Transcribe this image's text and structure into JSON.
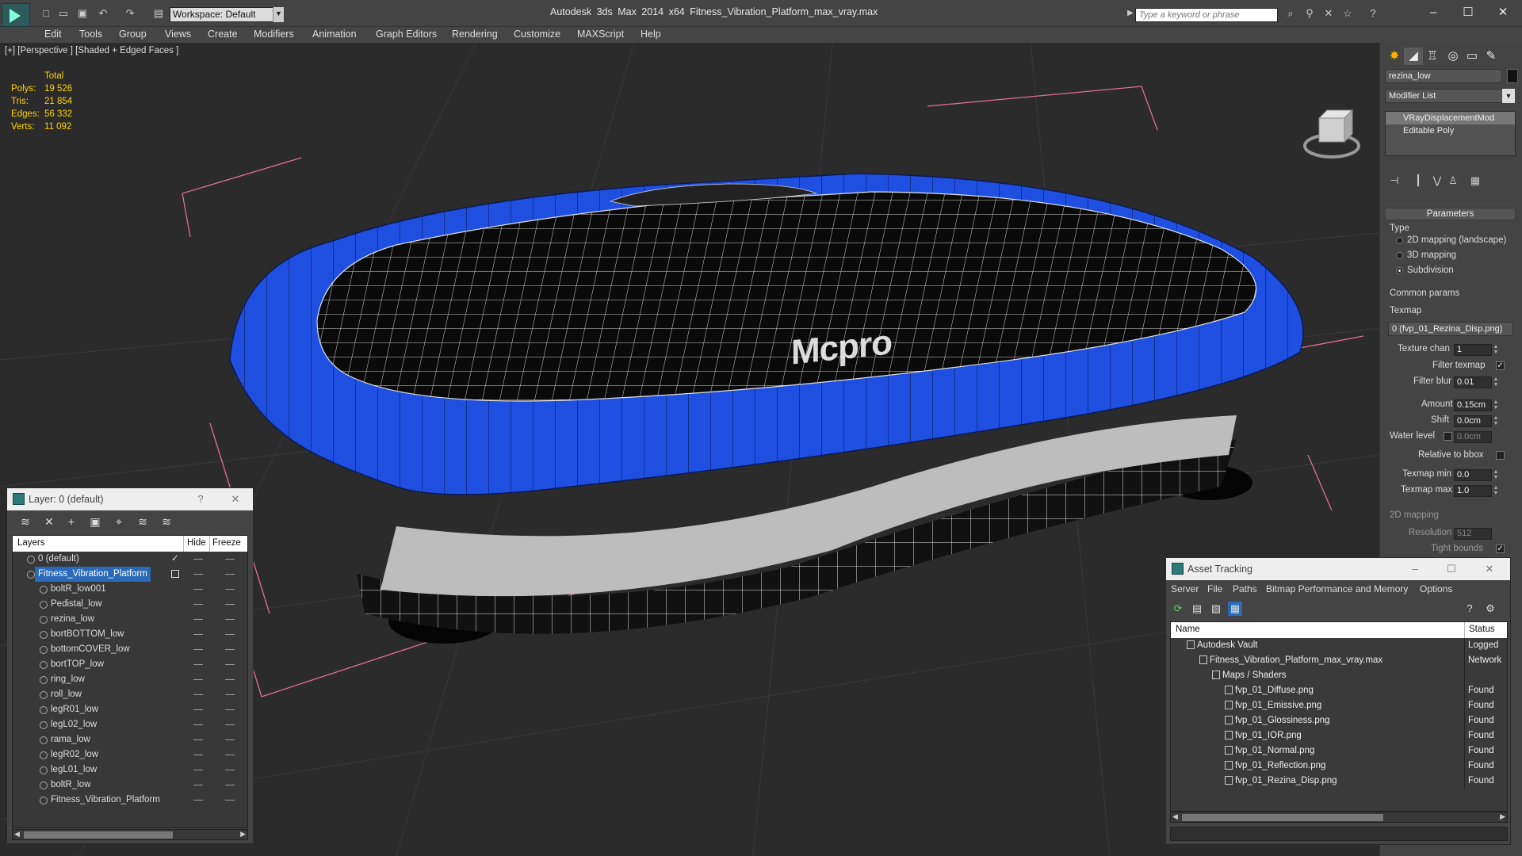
{
  "app": {
    "title": "Autodesk 3ds Max  2014 x64      Fitness_Vibration_Platform_max_vray.max",
    "workspace": "Workspace: Default",
    "search_placeholder": "Type a keyword or phrase"
  },
  "menu": [
    "Edit",
    "Tools",
    "Group",
    "Views",
    "Create",
    "Modifiers",
    "Animation",
    "Graph Editors",
    "Rendering",
    "Customize",
    "MAXScript",
    "Help"
  ],
  "viewport": {
    "label": "[+] [Perspective ] [Shaded + Edged Faces ]",
    "logo_text": "Mcpro",
    "stats": {
      "header": "Total",
      "rows": [
        {
          "k": "Polys:",
          "v": "19 526"
        },
        {
          "k": "Tris:",
          "v": "21 854"
        },
        {
          "k": "Edges:",
          "v": "56 332"
        },
        {
          "k": "Verts:",
          "v": "11 092"
        }
      ]
    }
  },
  "command_panel": {
    "object_name": "rezina_low",
    "modifier_list": "Modifier List",
    "stack": [
      "VRayDisplacementMod",
      "Editable Poly"
    ],
    "rollout_parameters": "Parameters",
    "type_label": "Type",
    "types": [
      "2D mapping (landscape)",
      "3D mapping",
      "Subdivision"
    ],
    "common_params": "Common params",
    "texmap_label": "Texmap",
    "texmap_value": "0 (fvp_01_Rezina_Disp.png)",
    "texture_chan_label": "Texture chan",
    "texture_chan": "1",
    "filter_texmap": "Filter texmap",
    "filter_blur_label": "Filter blur",
    "filter_blur": "0.01",
    "amount_label": "Amount",
    "amount": "0.15cm",
    "shift_label": "Shift",
    "shift": "0.0cm",
    "water_level_label": "Water level",
    "water_level": "0.0cm",
    "relative_bbox": "Relative to bbox",
    "texmap_min_label": "Texmap min",
    "texmap_min": "0.0",
    "texmap_max_label": "Texmap max",
    "texmap_max": "1.0",
    "mapping2d": "2D mapping",
    "resolution_label": "Resolution",
    "resolution": "512",
    "tight_bounds": "Tight bounds"
  },
  "layers": {
    "title": "Layer: 0 (default)",
    "help": "?",
    "col_layers": "Layers",
    "col_hide": "Hide",
    "col_freeze": "Freeze",
    "rows": [
      {
        "name": "0 (default)",
        "level": 0
      },
      {
        "name": "Fitness_Vibration_Platform",
        "level": 0,
        "selected": true
      },
      {
        "name": "boltR_low001",
        "level": 1
      },
      {
        "name": "Pedistal_low",
        "level": 1
      },
      {
        "name": "rezina_low",
        "level": 1
      },
      {
        "name": "bortBOTTOM_low",
        "level": 1
      },
      {
        "name": "bottomCOVER_low",
        "level": 1
      },
      {
        "name": "bortTOP_low",
        "level": 1
      },
      {
        "name": "ring_low",
        "level": 1
      },
      {
        "name": "roll_low",
        "level": 1
      },
      {
        "name": "legR01_low",
        "level": 1
      },
      {
        "name": "legL02_low",
        "level": 1
      },
      {
        "name": "rama_low",
        "level": 1
      },
      {
        "name": "legR02_low",
        "level": 1
      },
      {
        "name": "legL01_low",
        "level": 1
      },
      {
        "name": "boltR_low",
        "level": 1
      },
      {
        "name": "Fitness_Vibration_Platform",
        "level": 1
      }
    ]
  },
  "asset": {
    "title": "Asset Tracking",
    "menu": [
      "Server",
      "File",
      "Paths",
      "Bitmap Performance and Memory",
      "Options"
    ],
    "col_name": "Name",
    "col_status": "Status",
    "rows": [
      {
        "name": "Autodesk Vault",
        "status": "Logged",
        "indent": 0
      },
      {
        "name": "Fitness_Vibration_Platform_max_vray.max",
        "status": "Network",
        "indent": 1
      },
      {
        "name": "Maps / Shaders",
        "status": "",
        "indent": 2
      },
      {
        "name": "fvp_01_Diffuse.png",
        "status": "Found",
        "indent": 3
      },
      {
        "name": "fvp_01_Emissive.png",
        "status": "Found",
        "indent": 3
      },
      {
        "name": "fvp_01_Glossiness.png",
        "status": "Found",
        "indent": 3
      },
      {
        "name": "fvp_01_IOR.png",
        "status": "Found",
        "indent": 3
      },
      {
        "name": "fvp_01_Normal.png",
        "status": "Found",
        "indent": 3
      },
      {
        "name": "fvp_01_Reflection.png",
        "status": "Found",
        "indent": 3
      },
      {
        "name": "fvp_01_Rezina_Disp.png",
        "status": "Found",
        "indent": 3
      }
    ]
  },
  "colors": {
    "platform_blue": "#1f4fe0",
    "selection": "#2a6ab8",
    "stats_yellow": "#ffd400"
  }
}
